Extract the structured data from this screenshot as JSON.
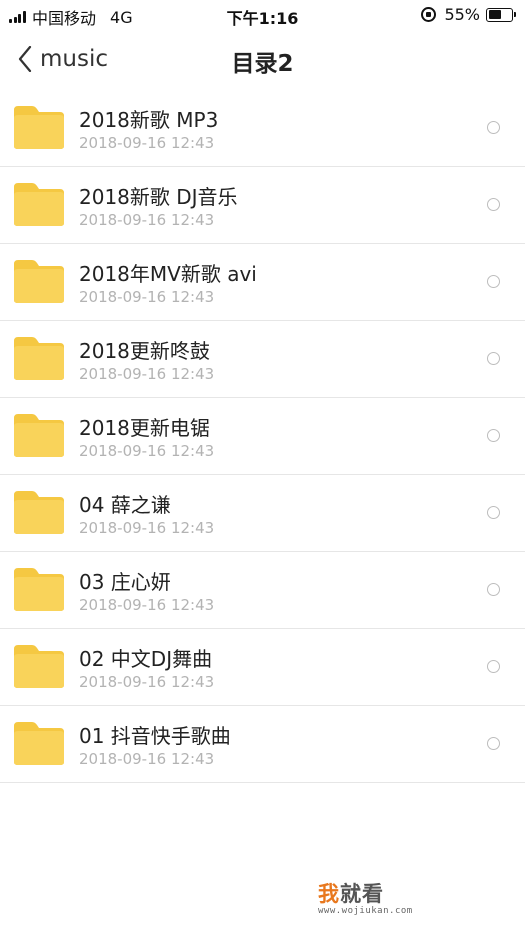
{
  "status_bar": {
    "carrier": "中国移动",
    "network": "4G",
    "time": "下午1:16",
    "battery": "55%",
    "battery_level": 0.55
  },
  "nav": {
    "back_label": "music",
    "title": "目录2"
  },
  "folders": [
    {
      "name": "2018新歌 MP3",
      "date": "2018-09-16 12:43"
    },
    {
      "name": "2018新歌 DJ音乐",
      "date": "2018-09-16 12:43"
    },
    {
      "name": "2018年MV新歌 avi",
      "date": "2018-09-16 12:43"
    },
    {
      "name": "2018更新咚鼓",
      "date": "2018-09-16 12:43"
    },
    {
      "name": "2018更新电锯",
      "date": "2018-09-16 12:43"
    },
    {
      "name": "04 薛之谦",
      "date": "2018-09-16 12:43"
    },
    {
      "name": "03 庄心妍",
      "date": "2018-09-16 12:43"
    },
    {
      "name": "02 中文DJ舞曲",
      "date": "2018-09-16 12:43"
    },
    {
      "name": "01 抖音快手歌曲",
      "date": "2018-09-16 12:43"
    }
  ],
  "watermark": {
    "first_char": "我",
    "rest": "就看",
    "url": "www.wojiukan.com"
  },
  "colors": {
    "folder": "#f9d35a",
    "folder_tab": "#f5c842",
    "divider": "#e6e6e6",
    "date_text": "#b3b3b3",
    "watermark_accent": "#e8781e"
  },
  "icons": {
    "back": "chevron-left-icon",
    "folder": "folder-icon",
    "select": "radio-circle-icon"
  }
}
